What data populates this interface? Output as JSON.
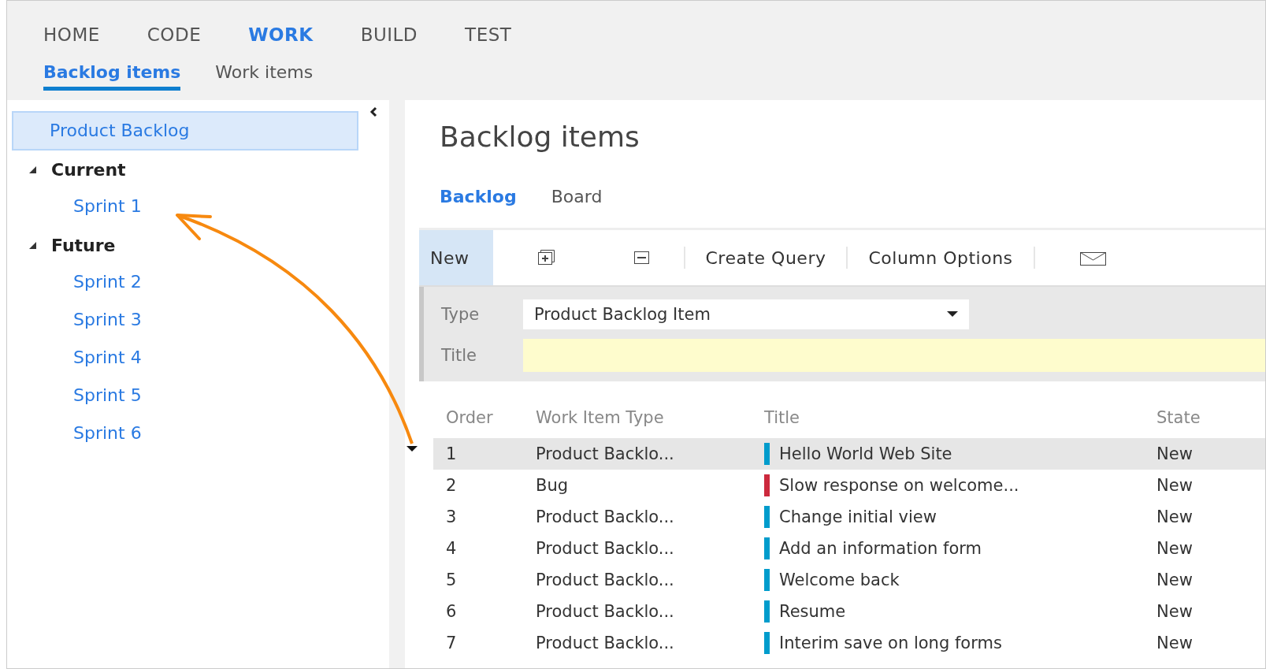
{
  "top_nav": [
    {
      "label": "HOME",
      "selected": false
    },
    {
      "label": "CODE",
      "selected": false
    },
    {
      "label": "WORK",
      "selected": true
    },
    {
      "label": "BUILD",
      "selected": false
    },
    {
      "label": "TEST",
      "selected": false
    }
  ],
  "sub_nav": [
    {
      "label": "Backlog items",
      "selected": true
    },
    {
      "label": "Work items",
      "selected": false
    }
  ],
  "sidebar": {
    "items": [
      {
        "label": "Product Backlog",
        "selected": true,
        "kind": "link"
      },
      {
        "label": "Current",
        "kind": "group",
        "expanded": true,
        "children": [
          {
            "label": "Sprint 1",
            "selected": false,
            "kind": "link"
          }
        ]
      },
      {
        "label": "Future",
        "kind": "group",
        "expanded": true,
        "children": [
          {
            "label": "Sprint 2",
            "selected": false,
            "kind": "link"
          },
          {
            "label": "Sprint 3",
            "selected": false,
            "kind": "link"
          },
          {
            "label": "Sprint 4",
            "selected": false,
            "kind": "link"
          },
          {
            "label": "Sprint 5",
            "selected": false,
            "kind": "link"
          },
          {
            "label": "Sprint 6",
            "selected": false,
            "kind": "link"
          }
        ]
      }
    ]
  },
  "page_title": "Backlog items",
  "view_tabs": [
    {
      "label": "Backlog",
      "selected": true
    },
    {
      "label": "Board",
      "selected": false
    }
  ],
  "toolbar": [
    {
      "kind": "text",
      "label": "New",
      "selected": true
    },
    {
      "kind": "expand"
    },
    {
      "kind": "collapse"
    },
    {
      "kind": "sep"
    },
    {
      "kind": "text",
      "label": "Create Query",
      "selected": false
    },
    {
      "kind": "sep"
    },
    {
      "kind": "text",
      "label": "Column Options",
      "selected": false
    },
    {
      "kind": "sep"
    },
    {
      "kind": "mail"
    }
  ],
  "form": {
    "type_label": "Type",
    "type_value": "Product Backlog Item",
    "title_label": "Title"
  },
  "table": {
    "columns": [
      "Order",
      "Work Item Type",
      "Title",
      "State"
    ],
    "rows": [
      {
        "order": "1",
        "type": "Product Backlo...",
        "title": "Hello World Web Site",
        "state": "New",
        "color": "#009ccc",
        "selected": true
      },
      {
        "order": "2",
        "type": "Bug",
        "title": "Slow response on welcome...",
        "state": "New",
        "color": "#cc293d",
        "selected": false
      },
      {
        "order": "3",
        "type": "Product Backlo...",
        "title": "Change initial view",
        "state": "New",
        "color": "#009ccc",
        "selected": false
      },
      {
        "order": "4",
        "type": "Product Backlo...",
        "title": "Add an information form",
        "state": "New",
        "color": "#009ccc",
        "selected": false
      },
      {
        "order": "5",
        "type": "Product Backlo...",
        "title": "Welcome back",
        "state": "New",
        "color": "#009ccc",
        "selected": false
      },
      {
        "order": "6",
        "type": "Product Backlo...",
        "title": "Resume",
        "state": "New",
        "color": "#009ccc",
        "selected": false
      },
      {
        "order": "7",
        "type": "Product Backlo...",
        "title": "Interim save on long forms",
        "state": "New",
        "color": "#009ccc",
        "selected": false
      }
    ]
  }
}
